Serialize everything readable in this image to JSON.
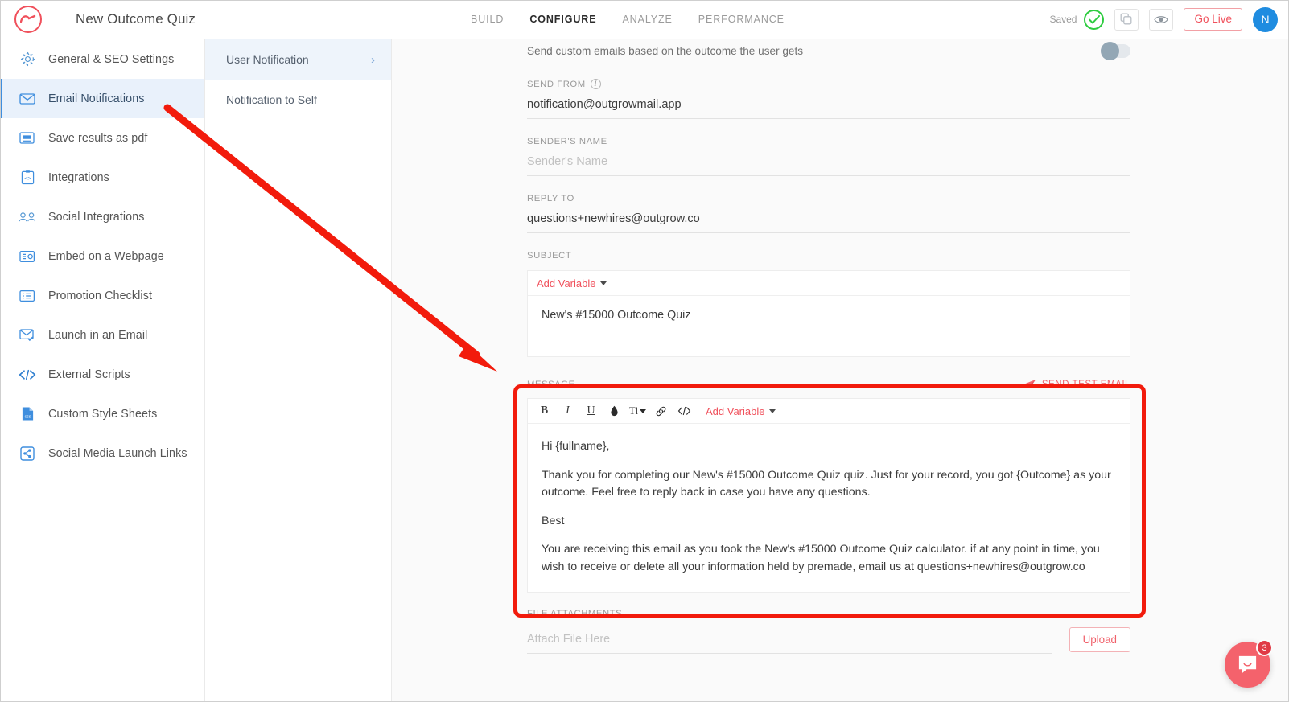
{
  "colors": {
    "brand_red": "#f0515c",
    "accent_blue": "#3f8ede",
    "annotation_red": "#f21b0c",
    "saved_green": "#2ecc40",
    "avatar_blue": "#1f8ce0"
  },
  "topbar": {
    "logo_name": "outgrow-logo",
    "quiz_title": "New Outcome Quiz",
    "tabs": [
      {
        "label": "BUILD",
        "active": false
      },
      {
        "label": "CONFIGURE",
        "active": true
      },
      {
        "label": "ANALYZE",
        "active": false
      },
      {
        "label": "PERFORMANCE",
        "active": false
      }
    ],
    "saved_label": "Saved",
    "go_live_label": "Go Live",
    "avatar_initial": "N"
  },
  "sidebar": {
    "items": [
      {
        "label": "General & SEO Settings",
        "icon": "gear-icon",
        "active": false
      },
      {
        "label": "Email Notifications",
        "icon": "envelope-icon",
        "active": true
      },
      {
        "label": "Save results as pdf",
        "icon": "pdf-icon",
        "active": false
      },
      {
        "label": "Integrations",
        "icon": "integrations-icon",
        "active": false
      },
      {
        "label": "Social Integrations",
        "icon": "people-icon",
        "active": false
      },
      {
        "label": "Embed on a Webpage",
        "icon": "embed-icon",
        "active": false
      },
      {
        "label": "Promotion Checklist",
        "icon": "checklist-icon",
        "active": false
      },
      {
        "label": "Launch in an Email",
        "icon": "envelope-check-icon",
        "active": false
      },
      {
        "label": "External Scripts",
        "icon": "code-icon",
        "active": false
      },
      {
        "label": "Custom Style Sheets",
        "icon": "css-file-icon",
        "active": false
      },
      {
        "label": "Social Media Launch Links",
        "icon": "share-icon",
        "active": false
      }
    ]
  },
  "subnav": {
    "items": [
      {
        "label": "User Notification",
        "active": true,
        "chevron": "›"
      },
      {
        "label": "Notification to Self",
        "active": false,
        "chevron": ""
      }
    ]
  },
  "main": {
    "intro_text": "Send custom emails based on the outcome the user gets",
    "send_from": {
      "label": "SEND FROM",
      "value": "notification@outgrowmail.app"
    },
    "sender_name": {
      "label": "SENDER'S NAME",
      "placeholder": "Sender's Name",
      "value": ""
    },
    "reply_to": {
      "label": "REPLY TO",
      "value": "questions+newhires@outgrow.co"
    },
    "subject": {
      "label": "SUBJECT",
      "add_variable_label": "Add Variable",
      "value": "New's #15000 Outcome Quiz"
    },
    "message": {
      "label": "MESSAGE",
      "send_test_label": "SEND TEST EMAIL",
      "add_variable_label": "Add Variable",
      "toolbar": [
        {
          "name": "bold-icon",
          "glyph": "B"
        },
        {
          "name": "italic-icon",
          "glyph": "I"
        },
        {
          "name": "underline-icon",
          "glyph": "U"
        },
        {
          "name": "text-color-icon",
          "glyph": "◆"
        },
        {
          "name": "text-size-icon",
          "glyph": "Tl"
        },
        {
          "name": "link-icon",
          "glyph": "🔗"
        },
        {
          "name": "source-code-icon",
          "glyph": "</>"
        }
      ],
      "body": [
        "Hi {fullname},",
        "Thank you for completing our New's #15000 Outcome Quiz quiz. Just for your record, you got {Outcome} as your outcome. Feel free to reply back in case you have any questions.",
        "Best",
        "You are receiving this email as you took the New's #15000 Outcome Quiz calculator. if at any point in time, you wish to receive or delete all your information held by premade, email us at questions+newhires@outgrow.co"
      ]
    },
    "file_attachments": {
      "label": "FILE ATTACHMENTS",
      "placeholder": "Attach File Here",
      "upload_label": "Upload"
    }
  },
  "intercom": {
    "badge_count": "3"
  }
}
